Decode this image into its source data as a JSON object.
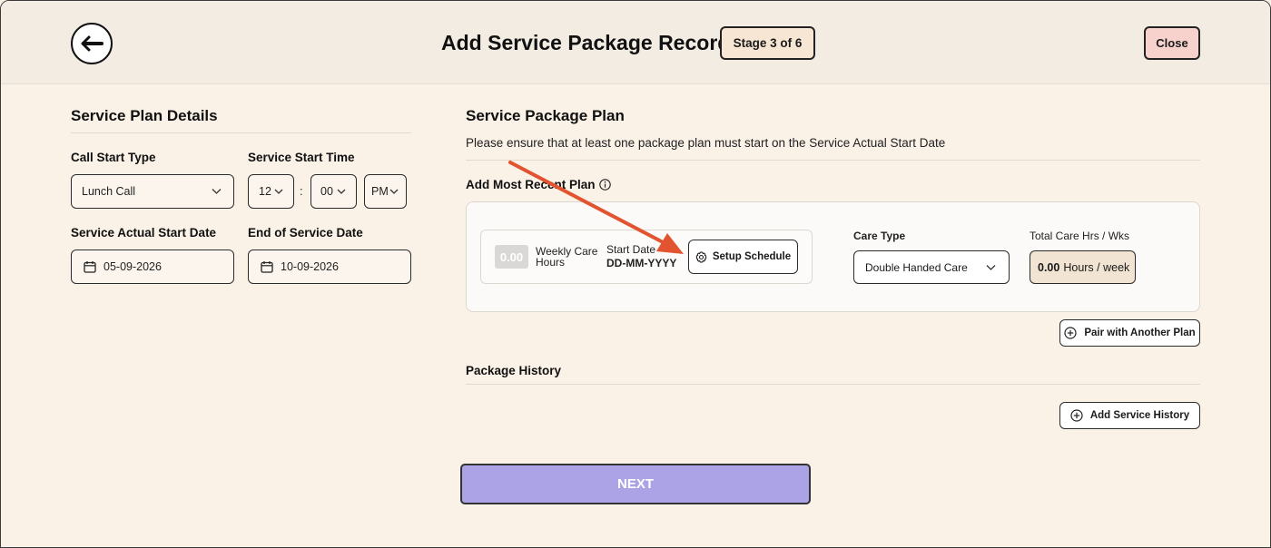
{
  "header": {
    "title": "Add Service Package Record",
    "stage": "Stage 3 of 6",
    "close_label": "Close"
  },
  "left": {
    "section_title": "Service Plan Details",
    "call_start_type_label": "Call Start Type",
    "call_start_type_value": "Lunch Call",
    "service_start_time_label": "Service Start Time",
    "hour": "12",
    "separator": ":",
    "minute": "00",
    "meridiem": "PM",
    "actual_start_label": "Service Actual Start Date",
    "actual_start_value": "05-09-2026",
    "end_date_label": "End of Service Date",
    "end_date_value": "10-09-2026"
  },
  "right": {
    "section_title": "Service Package Plan",
    "note": "Please ensure that at least one package plan must start on the Service Actual Start Date",
    "recent_plan_label": "Add Most Recent Plan",
    "plan": {
      "hours_value": "0.00",
      "weekly_care_line1": "Weekly Care",
      "weekly_care_line2": "Hours",
      "start_date_label": "Start Date",
      "start_date_value": "DD-MM-YYYY",
      "setup_schedule_label": "Setup Schedule",
      "care_type_label": "Care Type",
      "care_type_value": "Double Handed Care",
      "total_label": "Total Care Hrs / Wks",
      "total_value": "0.00",
      "total_unit": "Hours / week"
    },
    "pair_label": "Pair with Another Plan",
    "history_title": "Package History",
    "add_history_label": "Add Service History"
  },
  "footer": {
    "next_label": "NEXT"
  },
  "colors": {
    "background": "#faf1e7",
    "header_bg": "#f2ece3",
    "stage_bg": "#f6e6d3",
    "close_bg": "#f7d2cd",
    "next_bg": "#aca3e6",
    "arrow": "#e2532f"
  }
}
